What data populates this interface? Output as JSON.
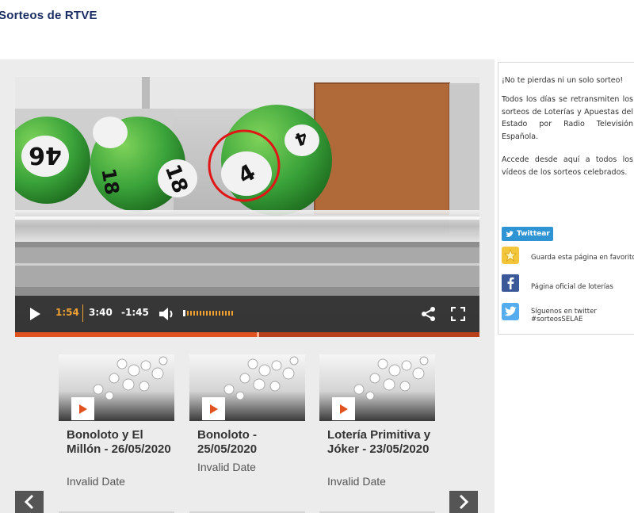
{
  "header": {
    "title": "Sorteos de RTVE"
  },
  "player": {
    "current_time": "1:54",
    "duration": "3:40",
    "remaining": "-1:45",
    "progress": 0.52,
    "ball_numbers": [
      "46",
      "18",
      "18",
      "4",
      "4"
    ]
  },
  "carousel": {
    "items": [
      {
        "title": "Bonoloto y El Millón - 26/05/2020",
        "date": "Invalid Date"
      },
      {
        "title": "Bonoloto - 25/05/2020",
        "date": "Invalid Date"
      },
      {
        "title": "Lotería Primitiva y Jóker - 23/05/2020",
        "date": "Invalid Date"
      }
    ]
  },
  "sidebar": {
    "headline": "¡No te pierdas ni un solo sorteo!",
    "paragraph1": "Todos los días se retransmiten los sorteos de Loterías y Apuestas del Estado por Radio Televisión Española.",
    "paragraph2": "Accede desde aquí a todos los vídeos de los sorteos celebrados.",
    "tweet_label": "Twittear",
    "links": [
      {
        "icon": "star-icon",
        "label": "Guarda esta página en favoritos"
      },
      {
        "icon": "facebook-icon",
        "label": "Página oficial de loterías"
      },
      {
        "icon": "twitter-icon",
        "label_line1": "Síguenos en twitter",
        "label_line2": "#sorteosSELAE"
      }
    ]
  },
  "colors": {
    "accent": "#e0521f",
    "header_text": "#1b2e63",
    "twitter_blue": "#2f94d4",
    "ball_green": "#3aa33a"
  }
}
